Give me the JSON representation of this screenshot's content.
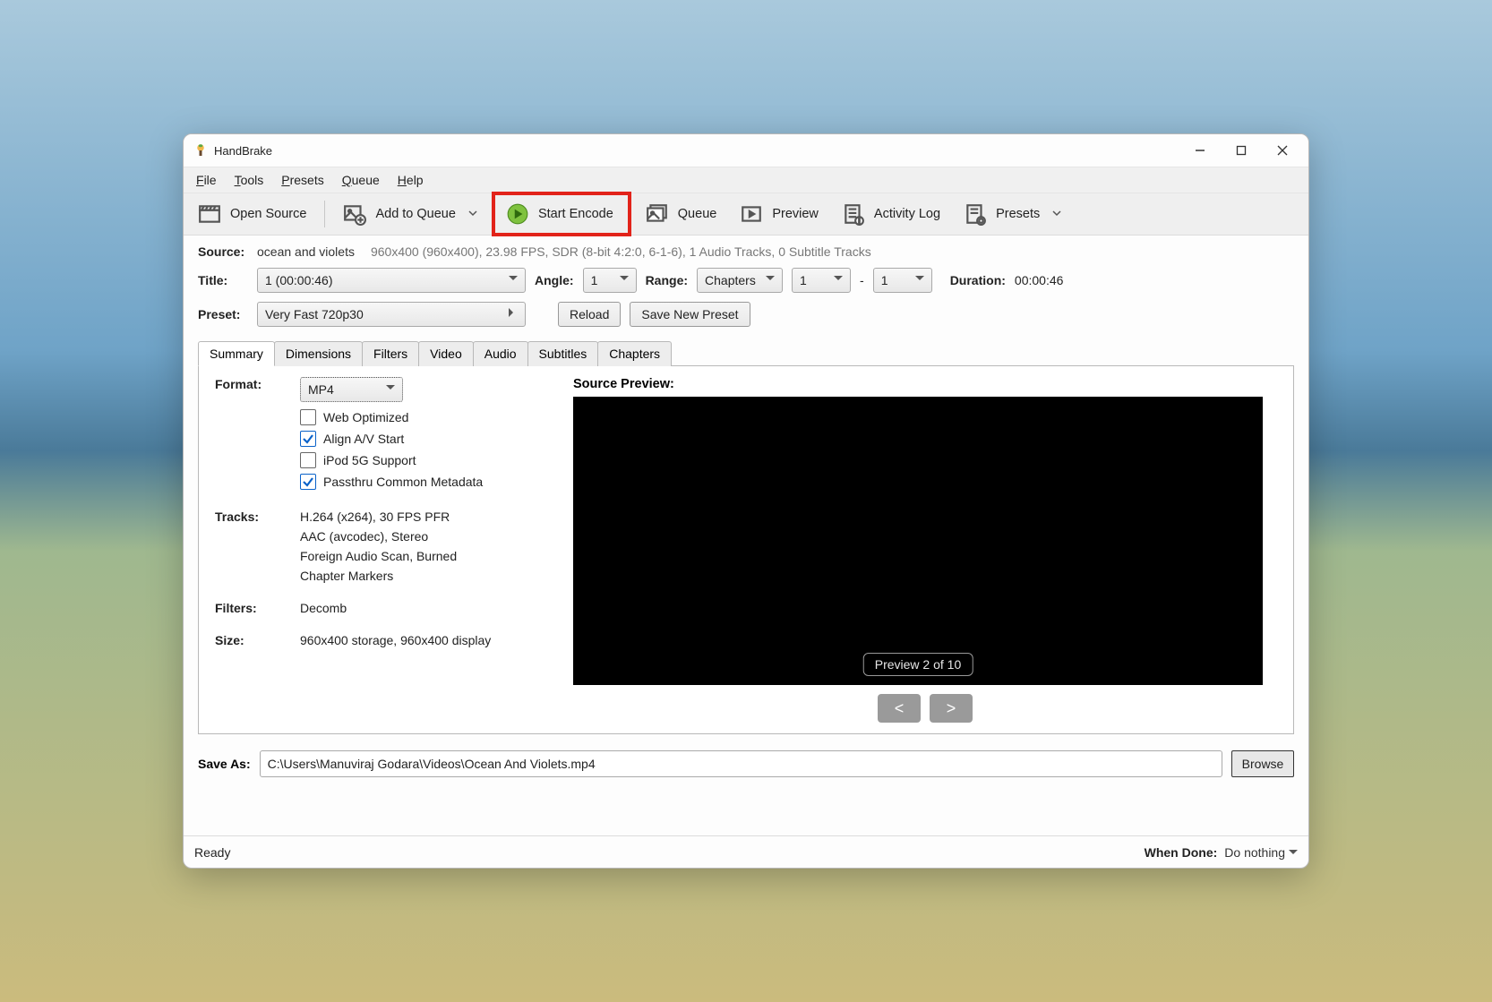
{
  "window": {
    "title": "HandBrake"
  },
  "menu": {
    "file": "File",
    "tools": "Tools",
    "presets": "Presets",
    "queue": "Queue",
    "help": "Help"
  },
  "toolbar": {
    "open_source": "Open Source",
    "add_to_queue": "Add to Queue",
    "start_encode": "Start Encode",
    "queue": "Queue",
    "preview": "Preview",
    "activity_log": "Activity Log",
    "presets": "Presets"
  },
  "source": {
    "label": "Source:",
    "name": "ocean and violets",
    "meta": "960x400 (960x400), 23.98 FPS, SDR (8-bit 4:2:0, 6-1-6), 1 Audio Tracks, 0 Subtitle Tracks"
  },
  "title": {
    "label": "Title:",
    "value": "1  (00:00:46)"
  },
  "angle": {
    "label": "Angle:",
    "value": "1"
  },
  "range": {
    "label": "Range:",
    "type": "Chapters",
    "from": "1",
    "to": "1",
    "dash": "-"
  },
  "duration": {
    "label": "Duration:",
    "value": "00:00:46"
  },
  "preset": {
    "label": "Preset:",
    "value": "Very Fast 720p30",
    "reload": "Reload",
    "save_new": "Save New Preset"
  },
  "tabs": [
    "Summary",
    "Dimensions",
    "Filters",
    "Video",
    "Audio",
    "Subtitles",
    "Chapters"
  ],
  "summary": {
    "format_label": "Format:",
    "format_value": "MP4",
    "opts": {
      "web_optimized": "Web Optimized",
      "align_av": "Align A/V Start",
      "ipod_5g": "iPod 5G Support",
      "passthru_meta": "Passthru Common Metadata"
    },
    "opts_checked": {
      "web_optimized": false,
      "align_av": true,
      "ipod_5g": false,
      "passthru_meta": true
    },
    "tracks_label": "Tracks:",
    "tracks": [
      "H.264 (x264), 30 FPS PFR",
      "AAC (avcodec), Stereo",
      "Foreign Audio Scan, Burned",
      "Chapter Markers"
    ],
    "filters_label": "Filters:",
    "filters_value": "Decomb",
    "size_label": "Size:",
    "size_value": "960x400 storage, 960x400 display"
  },
  "preview": {
    "label": "Source Preview:",
    "chip": "Preview 2 of 10",
    "prev": "<",
    "next": ">"
  },
  "saveas": {
    "label": "Save As:",
    "value": "C:\\Users\\Manuviraj Godara\\Videos\\Ocean And Violets.mp4",
    "browse": "Browse"
  },
  "status": {
    "text": "Ready",
    "when_done_label": "When Done:",
    "when_done_value": "Do nothing"
  }
}
